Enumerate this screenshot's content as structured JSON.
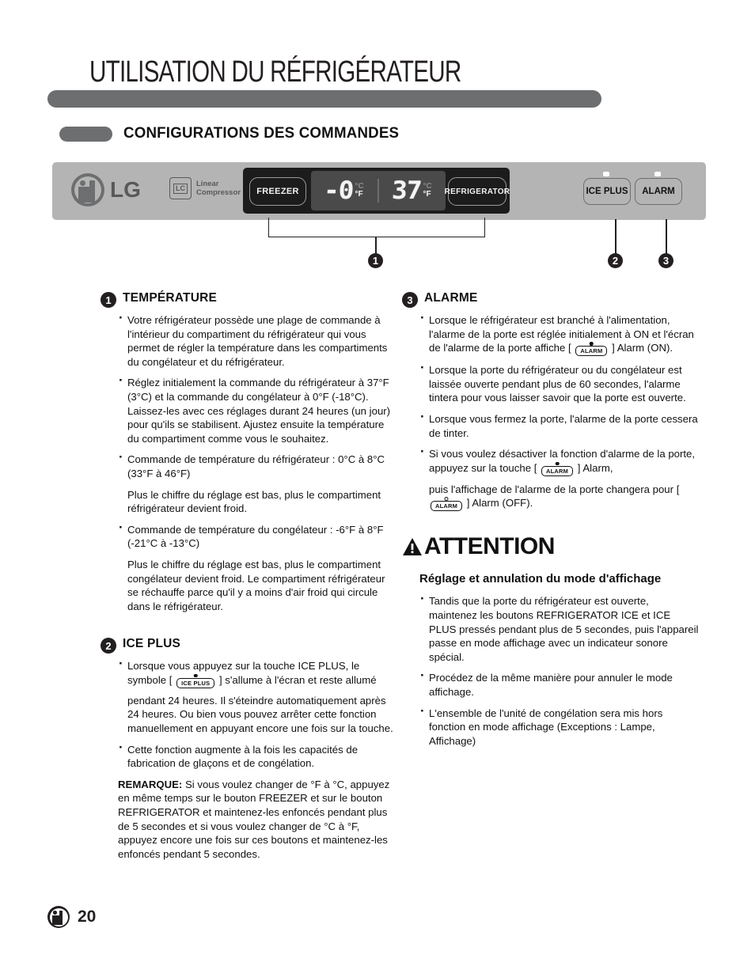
{
  "page": {
    "title": "UTILISATION DU RÉFRIGÉRATEUR",
    "section_title": "CONFIGURATIONS DES COMMANDES",
    "page_number": "20"
  },
  "control_panel": {
    "brand": "LG",
    "compressor_badge": "LC",
    "compressor_line1": "Linear",
    "compressor_line2": "Compressor",
    "freezer_button": "FREEZER",
    "refrigerator_button": "REFRIGERATOR",
    "freezer_display": "-0",
    "refrigerator_display": "37",
    "unit_celsius": "°C",
    "unit_fahrenheit": "°F",
    "ice_plus_button": "ICE PLUS",
    "alarm_button": "ALARM",
    "callouts": [
      "1",
      "2",
      "3"
    ],
    "colors": {
      "panel_bg": "#b4b4b4",
      "lcd_bg": "#4a4a4a",
      "black_panel": "#1c1c1c",
      "header_bar": "#6d6e70"
    }
  },
  "sections": {
    "temperature": {
      "number": "1",
      "heading": "TEMPÉRATURE",
      "bullets": [
        "Votre réfrigérateur possède une plage de commande à l'intérieur du compartiment du réfrigérateur qui vous permet de régler la température dans les compartiments du congélateur et du réfrigérateur.",
        "Réglez initialement la commande du réfrigérateur à 37°F (3°C) et la commande du congélateur à 0°F (-18°C). Laissez-les avec ces réglages durant 24 heures (un jour) pour qu'ils se stabilisent. Ajustez ensuite la température du compartiment comme vous le souhaitez.",
        "Commande de température du réfrigérateur : 0°C à 8°C (33°F à 46°F)"
      ],
      "para_after_3": "Plus le chiffre du réglage est bas, plus le compartiment réfrigérateur devient froid.",
      "bullet_4": "Commande de température du congélateur : -6°F à 8°F (-21°C à -13°C)",
      "para_after_4": "Plus le chiffre du réglage est bas, plus le compartiment congélateur devient froid. Le compartiment réfrigérateur se réchauffe parce qu'il y a moins d'air froid qui circule dans le réfrigérateur."
    },
    "ice_plus": {
      "number": "2",
      "heading": "ICE PLUS",
      "bullet_1_part_a": "Lorsque vous appuyez sur la touche ICE PLUS, le symbole [",
      "icon_label": "ICE PLUS",
      "bullet_1_part_b": "] s'allume à l'écran et reste allumé",
      "bullet_1_part_c": "pendant 24 heures. Il s'éteindre automatiquement après 24 heures. Ou bien vous pouvez arrêter cette fonction manuellement en appuyant encore une fois sur la touche.",
      "bullet_2": "Cette fonction augmente à la fois les capacités de fabrication de glaçons et de congélation.",
      "note_label": "REMARQUE:",
      "note_text": " Si vous voulez changer de °F à °C, appuyez en même temps sur le bouton FREEZER et sur le bouton REFRIGERATOR et maintenez-les enfoncés pendant plus de 5 secondes et si vous voulez changer de °C à °F, appuyez encore une fois sur ces boutons et maintenez-les enfoncés pendant 5 secondes."
    },
    "alarme": {
      "number": "3",
      "heading": "ALARME",
      "bullet_1_part_a": "Lorsque le réfrigérateur est branché à l'alimentation, l'alarme de la porte est réglée initialement à ON et l'écran de l'alarme de la porte affiche [",
      "icon_label": "ALARM",
      "bullet_1_part_b": "] Alarm (ON).",
      "bullet_2": "Lorsque la porte du réfrigérateur ou du congélateur est laissée ouverte pendant plus de 60 secondes, l'alarme tintera pour vous laisser savoir que la porte est ouverte.",
      "bullet_3": "Lorsque vous fermez la porte, l'alarme de la porte cessera de tinter.",
      "bullet_4_part_a": "Si vous voulez désactiver la fonction d'alarme de la porte, appuyez sur la touche [",
      "bullet_4_part_b": "] Alarm,",
      "para_a": "puis l'affichage de l'alarme de la porte changera pour [",
      "para_b": "] Alarm (OFF)."
    },
    "attention": {
      "title": "ATTENTION",
      "sub_heading": "Réglage et annulation du mode d'affichage",
      "bullets": [
        "Tandis que la porte du réfrigérateur est ouverte, maintenez les boutons REFRIGERATOR ICE et ICE PLUS pressés pendant plus de 5 secondes, puis l'appareil passe en mode affichage avec un indicateur sonore spécial.",
        "Procédez de la même manière pour annuler le mode affichage.",
        "L'ensemble de l'unité de congélation sera mis hors fonction en mode affichage (Exceptions : Lampe, Affichage)"
      ]
    }
  }
}
